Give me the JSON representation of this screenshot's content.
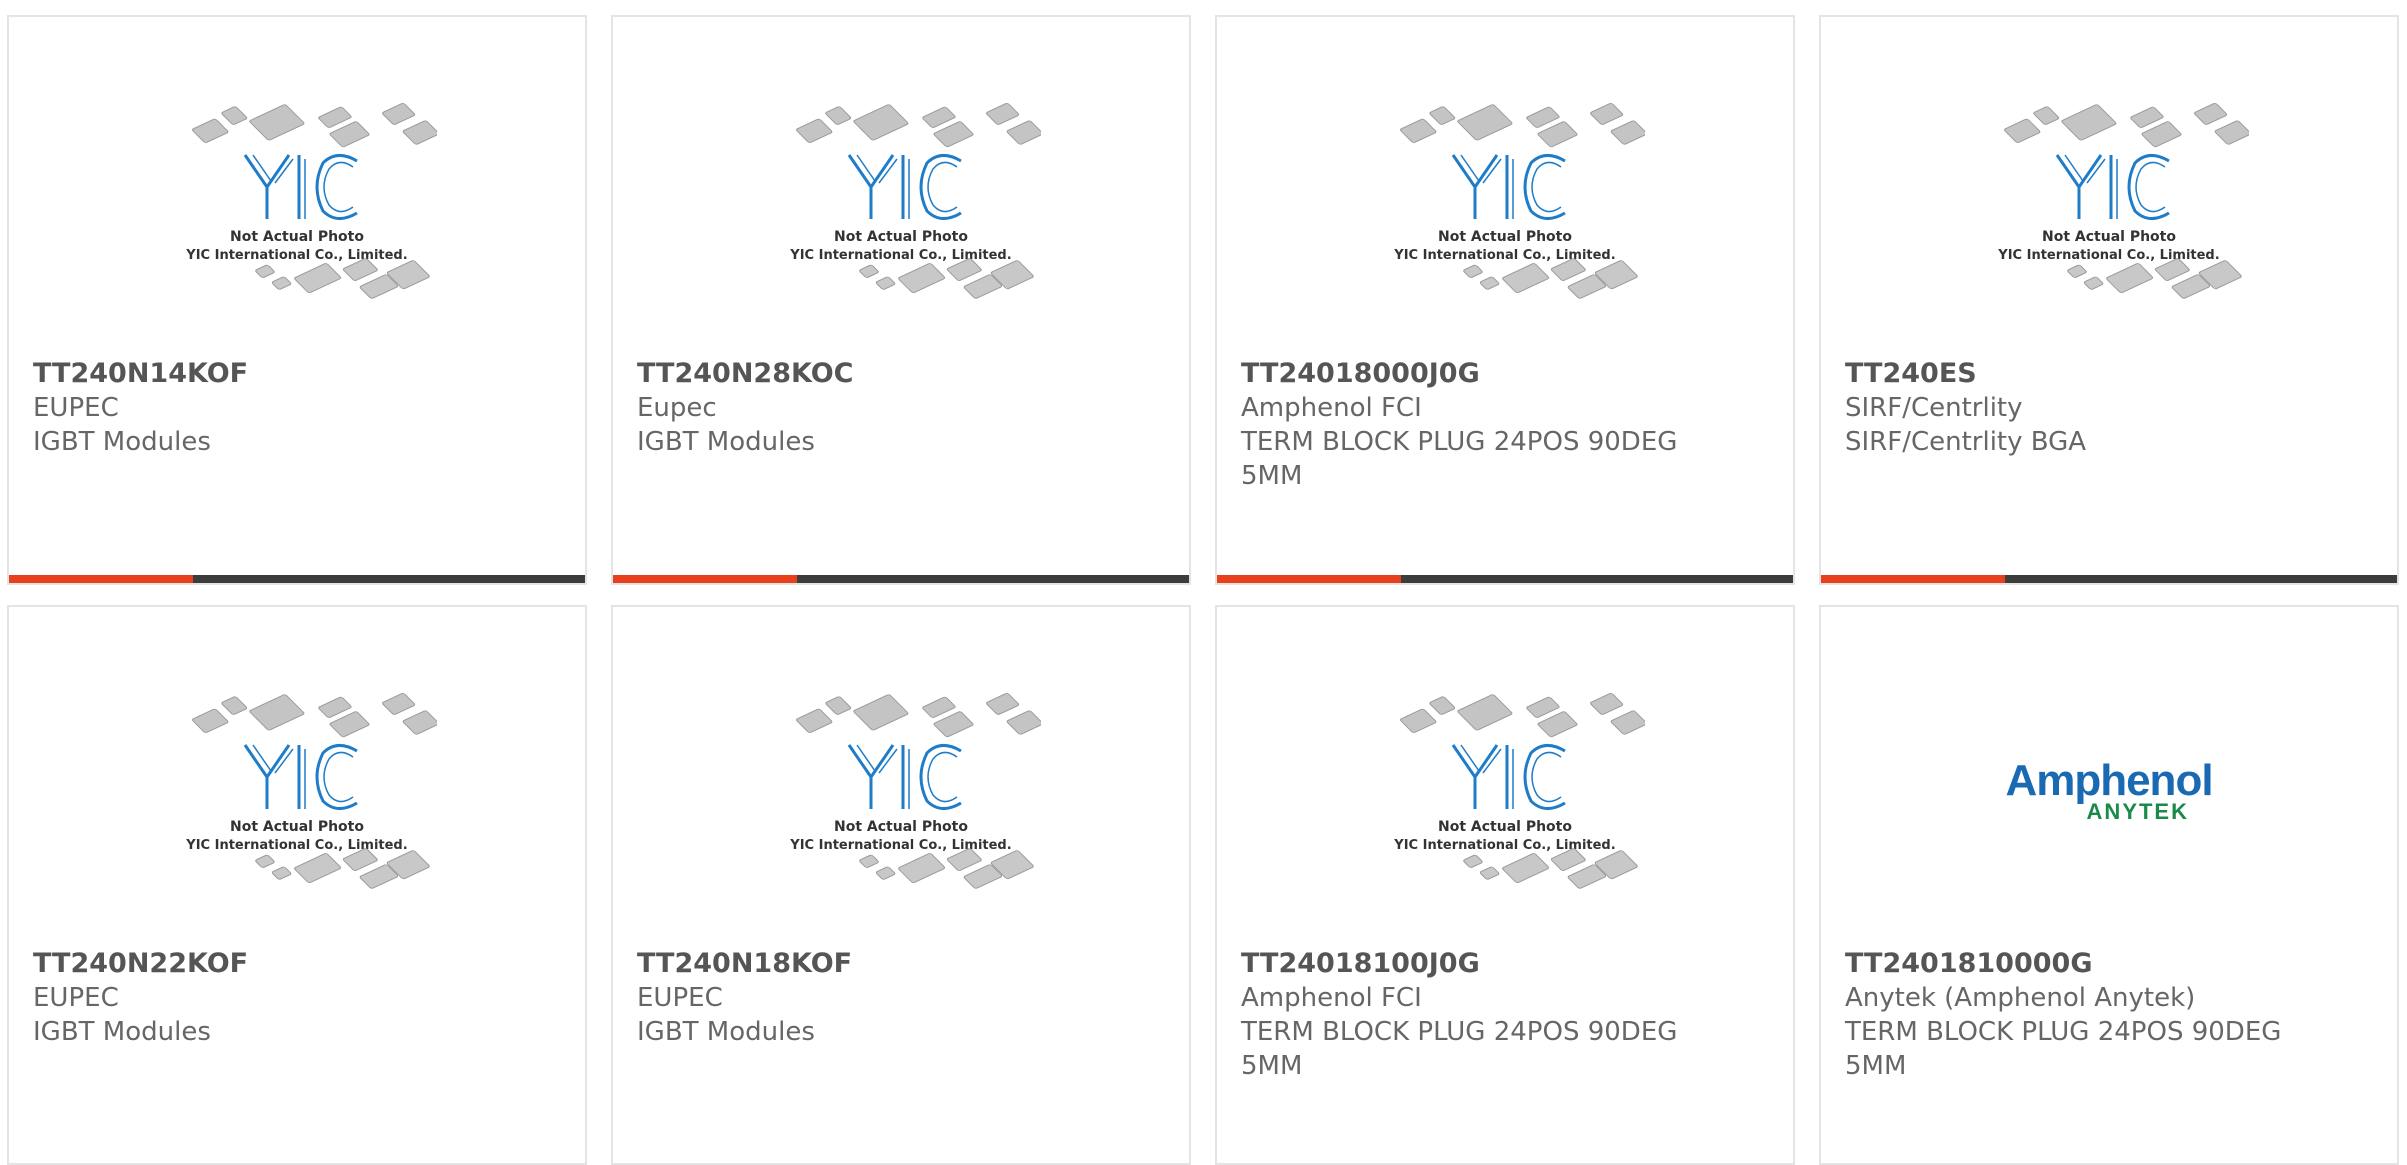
{
  "colors": {
    "accent": "#e8401c",
    "track": "#3c3c3c",
    "text": "#666666",
    "yic_blue": "#1e7cc8"
  },
  "placeholder": {
    "line1": "Not Actual Photo",
    "line2": "YIC International Co., Limited."
  },
  "amphenol_logo": {
    "brand": "Amphenol",
    "sub": "ANYTEK"
  },
  "products": [
    {
      "part": "TT240N14KOF",
      "mfr": "EUPEC",
      "desc": "IGBT Modules",
      "image": "yic-placeholder",
      "progress": 0.32
    },
    {
      "part": "TT240N28KOC",
      "mfr": "Eupec",
      "desc": "IGBT Modules",
      "image": "yic-placeholder",
      "progress": 0.32
    },
    {
      "part": "TT24018000J0G",
      "mfr": "Amphenol FCI",
      "desc": "TERM BLOCK PLUG 24POS 90DEG 5MM",
      "image": "yic-placeholder",
      "progress": 0.32
    },
    {
      "part": "TT240ES",
      "mfr": "SIRF/Centrlity",
      "desc": "SIRF/Centrlity BGA",
      "image": "yic-placeholder",
      "progress": 0.32
    },
    {
      "part": "TT240N22KOF",
      "mfr": "EUPEC",
      "desc": "IGBT Modules",
      "image": "yic-placeholder"
    },
    {
      "part": "TT240N18KOF",
      "mfr": "EUPEC",
      "desc": "IGBT Modules",
      "image": "yic-placeholder"
    },
    {
      "part": "TT24018100J0G",
      "mfr": "Amphenol FCI",
      "desc": "TERM BLOCK PLUG 24POS 90DEG 5MM",
      "image": "yic-placeholder"
    },
    {
      "part": "TT2401810000G",
      "mfr": "Anytek (Amphenol Anytek)",
      "desc": "TERM BLOCK PLUG 24POS 90DEG 5MM",
      "image": "amphenol-anytek-logo"
    }
  ]
}
